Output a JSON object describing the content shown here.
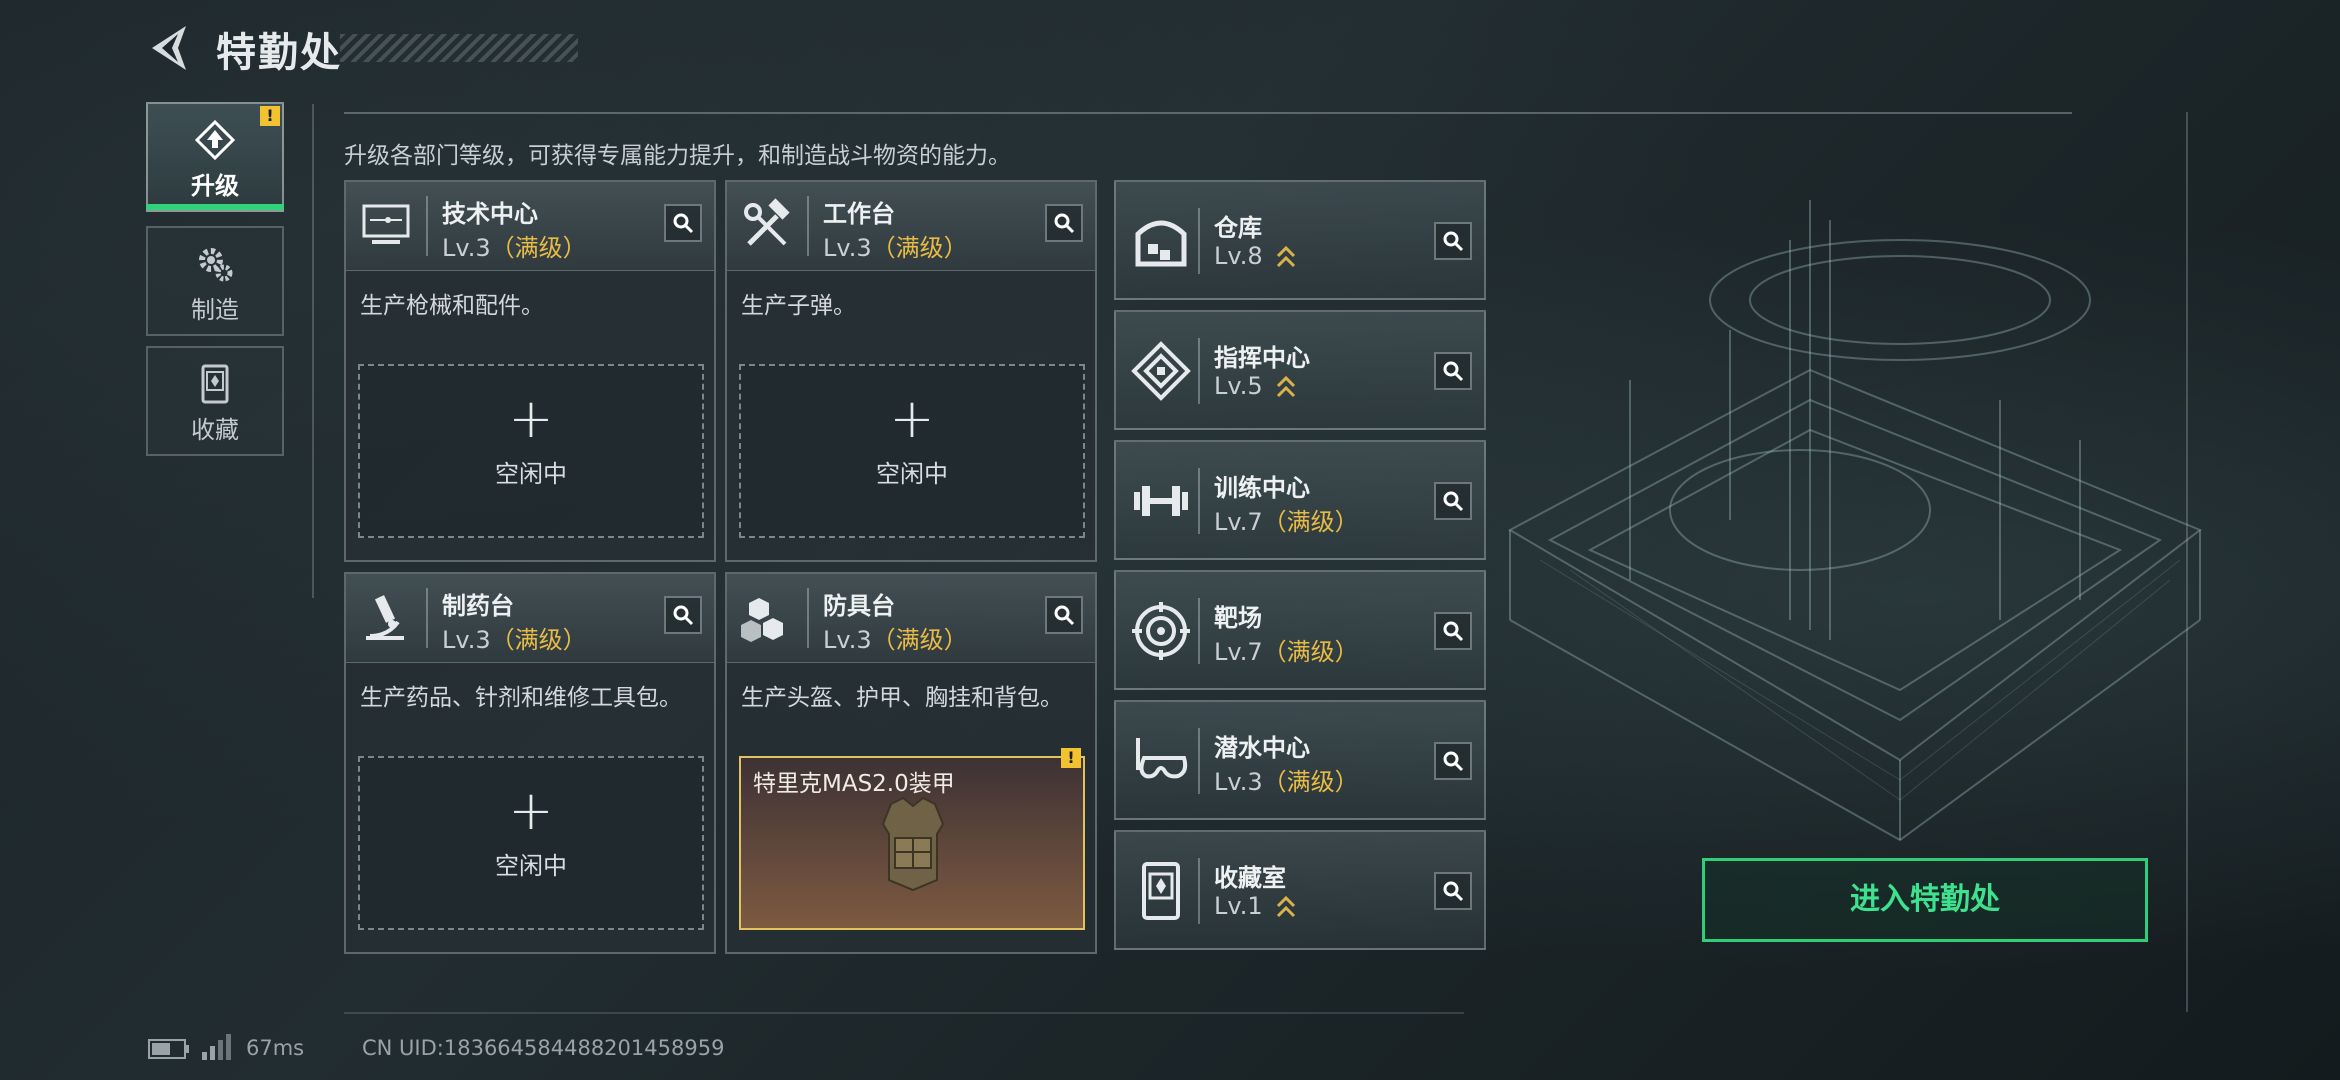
{
  "header": {
    "title": "特勤处"
  },
  "tabs": [
    {
      "label": "升级",
      "icon": "upgrade-icon",
      "active": true,
      "alert": "!"
    },
    {
      "label": "制造",
      "icon": "gears-icon",
      "active": false
    },
    {
      "label": "收藏",
      "icon": "collection-icon",
      "active": false
    }
  ],
  "subtitle": "升级各部门等级，可获得专属能力提升，和制造战斗物资的能力。",
  "workshops": [
    {
      "name": "技术中心",
      "level": "Lv.3",
      "max_label": "（满级）",
      "desc": "生产枪械和配件。",
      "slot_plus": "+",
      "slot_label": "空闲中",
      "icon": "computer-icon"
    },
    {
      "name": "工作台",
      "level": "Lv.3",
      "max_label": "（满级）",
      "desc": "生产子弹。",
      "slot_plus": "+",
      "slot_label": "空闲中",
      "icon": "tools-icon"
    },
    {
      "name": "制药台",
      "level": "Lv.3",
      "max_label": "（满级）",
      "desc": "生产药品、针剂和维修工具包。",
      "slot_plus": "+",
      "slot_label": "空闲中",
      "icon": "microscope-icon"
    },
    {
      "name": "防具台",
      "level": "Lv.3",
      "max_label": "（满级）",
      "desc": "生产头盔、护甲、胸挂和背包。",
      "item_name": "特里克MAS2.0装甲",
      "item_alert": "!",
      "icon": "armor-blocks-icon"
    }
  ],
  "facilities": [
    {
      "name": "仓库",
      "level": "Lv.8",
      "max_label": "",
      "upgradable": true,
      "icon": "warehouse-icon"
    },
    {
      "name": "指挥中心",
      "level": "Lv.5",
      "max_label": "",
      "upgradable": true,
      "icon": "command-icon"
    },
    {
      "name": "训练中心",
      "level": "Lv.7",
      "max_label": "（满级）",
      "upgradable": false,
      "icon": "dumbbell-icon"
    },
    {
      "name": "靶场",
      "level": "Lv.7",
      "max_label": "（满级）",
      "upgradable": false,
      "icon": "target-icon"
    },
    {
      "name": "潜水中心",
      "level": "Lv.3",
      "max_label": "（满级）",
      "upgradable": false,
      "icon": "diving-mask-icon"
    },
    {
      "name": "收藏室",
      "level": "Lv.1",
      "max_label": "",
      "upgradable": true,
      "icon": "collection-room-icon"
    }
  ],
  "enter_button": "进入特勤处",
  "status": {
    "ping": "67ms",
    "uid": "CN UID:1836645844882014589​59"
  },
  "colors": {
    "accent_green": "#33d17a",
    "max_gold": "#e8bb45",
    "alert_yellow": "#f2c230"
  }
}
